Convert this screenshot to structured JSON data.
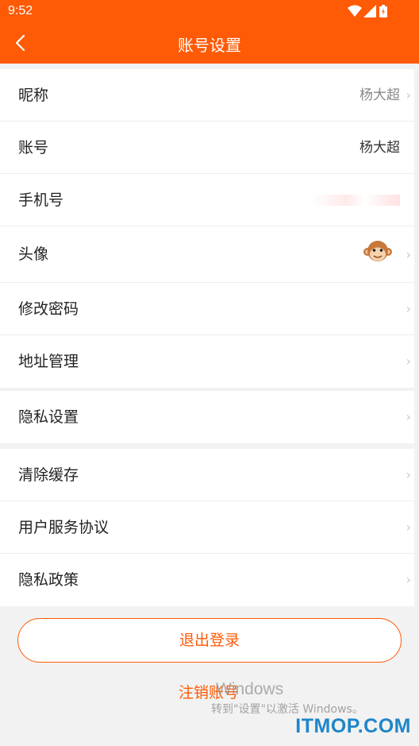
{
  "status_bar": {
    "time": "9:52"
  },
  "header": {
    "title": "账号设置",
    "back_icon": "back-arrow-icon"
  },
  "colors": {
    "accent": "#ff5a05",
    "watermark_logo": "#1e86c8"
  },
  "group1": {
    "nickname": {
      "label": "昵称",
      "value": "杨大超"
    },
    "account": {
      "label": "账号",
      "value": "杨大超"
    },
    "phone": {
      "label": "手机号"
    },
    "avatar": {
      "label": "头像",
      "icon": "monkey-avatar-icon"
    },
    "change_password": {
      "label": "修改密码"
    },
    "address": {
      "label": "地址管理"
    }
  },
  "group2": {
    "privacy_settings": {
      "label": "隐私设置"
    }
  },
  "group3": {
    "clear_cache": {
      "label": "清除缓存"
    },
    "user_agreement": {
      "label": "用户服务协议"
    },
    "privacy_policy": {
      "label": "隐私政策"
    }
  },
  "actions": {
    "logout": "退出登录",
    "deactivate": "注销账号"
  },
  "watermark": {
    "windows_title": "Windows",
    "windows_hint": "转到\"设置\"以激活 Windows。",
    "site": "ITMOP.COM"
  }
}
